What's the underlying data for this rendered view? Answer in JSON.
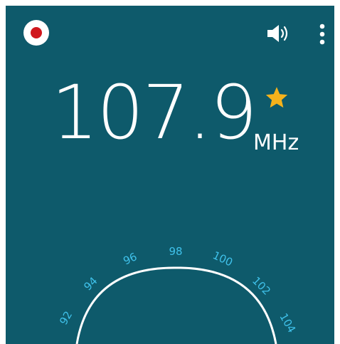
{
  "header": {
    "record_icon": "record-icon",
    "volume_icon": "volume-icon",
    "menu_icon": "more-vertical-icon"
  },
  "tuner": {
    "frequency": "107.9",
    "unit": "MHz",
    "favorite_icon": "star-icon",
    "favorite_color": "#f5b21b"
  },
  "dial": {
    "labels": [
      "92",
      "94",
      "96",
      "98",
      "100",
      "102",
      "104"
    ],
    "label_color": "#3fc1ea"
  },
  "colors": {
    "background": "#0e5a6b",
    "record_red": "#d0161c"
  }
}
